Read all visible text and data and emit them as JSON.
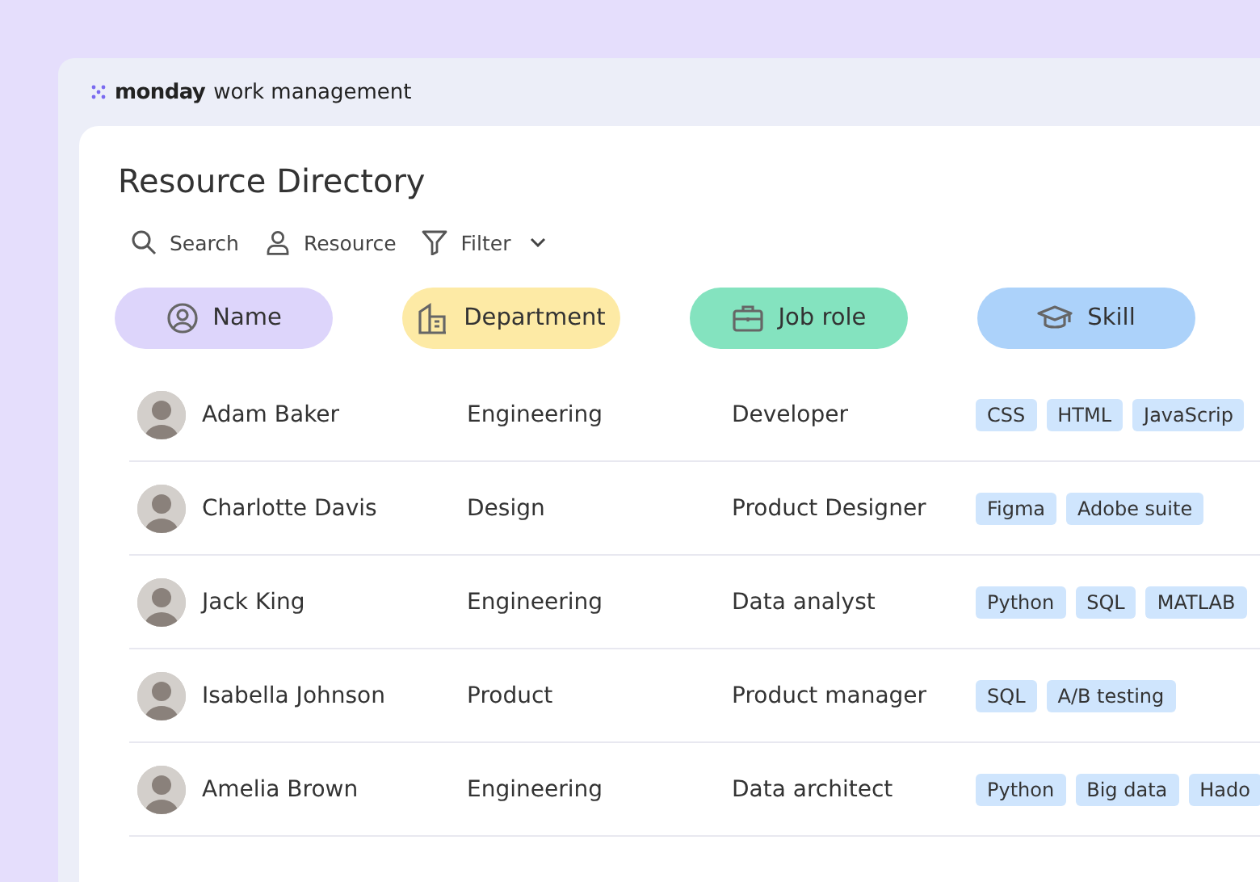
{
  "brand": {
    "name": "monday",
    "suffix": "work management"
  },
  "title": "Resource Directory",
  "toolbar": [
    {
      "kind": "search",
      "label": "Search"
    },
    {
      "kind": "person",
      "label": "Resource"
    },
    {
      "kind": "filter",
      "label": "Filter"
    }
  ],
  "columns": [
    {
      "kind": "person",
      "label": "Name",
      "color": "#ddd5fb"
    },
    {
      "kind": "building",
      "label": "Department",
      "color": "#fdeaa5"
    },
    {
      "kind": "briefcase",
      "label": "Job role",
      "color": "#84e3bf"
    },
    {
      "kind": "cap",
      "label": "Skill",
      "color": "#acd2fa"
    }
  ],
  "rows": [
    {
      "name": "Adam Baker",
      "department": "Engineering",
      "job_role": "Developer",
      "skills": [
        "CSS",
        "HTML",
        "JavaScrip"
      ]
    },
    {
      "name": "Charlotte Davis",
      "department": "Design",
      "job_role": "Product Designer",
      "skills": [
        "Figma",
        "Adobe suite"
      ]
    },
    {
      "name": "Jack King",
      "department": "Engineering",
      "job_role": "Data analyst",
      "skills": [
        "Python",
        "SQL",
        "MATLAB"
      ]
    },
    {
      "name": "Isabella Johnson",
      "department": "Product",
      "job_role": "Product manager",
      "skills": [
        "SQL",
        "A/B testing"
      ]
    },
    {
      "name": "Amelia Brown",
      "department": "Engineering",
      "job_role": "Data architect",
      "skills": [
        "Python",
        "Big data",
        "Hado"
      ]
    }
  ]
}
